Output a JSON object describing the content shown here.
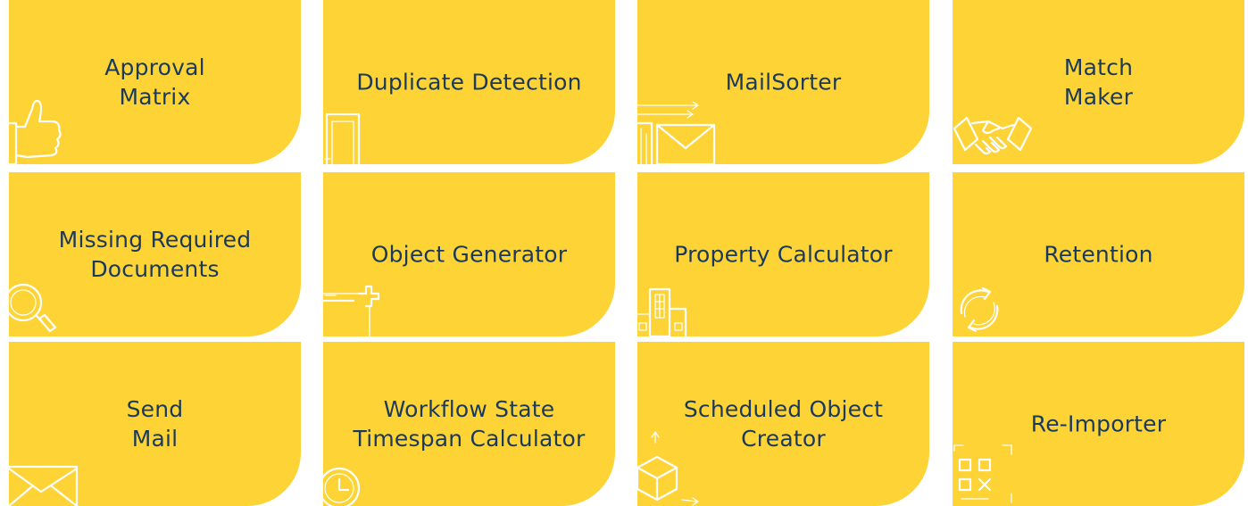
{
  "tiles": [
    {
      "label": "Approval\nMatrix",
      "icon": "thumbs-up-icon"
    },
    {
      "label": "Duplicate Detection",
      "icon": "documents-icon"
    },
    {
      "label": "MailSorter",
      "icon": "envelopes-icon"
    },
    {
      "label": "Match\nMaker",
      "icon": "handshake-icon"
    },
    {
      "label": "Missing Required\nDocuments",
      "icon": "magnifier-icon"
    },
    {
      "label": "Object Generator",
      "icon": "add-object-icon"
    },
    {
      "label": "Property Calculator",
      "icon": "buildings-icon"
    },
    {
      "label": "Retention",
      "icon": "refresh-icon"
    },
    {
      "label": "Send\nMail",
      "icon": "envelope-icon"
    },
    {
      "label": "Workflow State\nTimespan Calculator",
      "icon": "clock-icon"
    },
    {
      "label": "Scheduled Object\nCreator",
      "icon": "cube-icon"
    },
    {
      "label": "Re-Importer",
      "icon": "qr-scan-icon"
    }
  ],
  "colors": {
    "tile_background": "#FDD335",
    "label_text": "#1B3A5B",
    "icon_stroke": "#FFFFFF",
    "page_background": "#FFFFFF"
  }
}
